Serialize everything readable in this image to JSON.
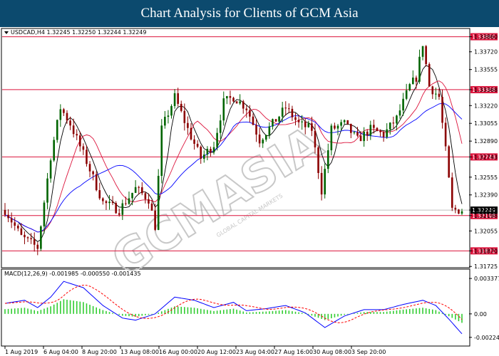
{
  "header": {
    "title": "Chart Analysis for Clients of GCM Asia"
  },
  "price_panel": {
    "info": "USDCAD,H4  1.32245 1.32250 1.32244 1.32249",
    "axis_ticks": [
      "1.33860",
      "1.33720",
      "1.33555",
      "1.33368",
      "1.33220",
      "1.33055",
      "1.32890",
      "1.32743",
      "1.32555",
      "1.32390",
      "1.32249",
      "1.32198",
      "1.32055",
      "1.31870",
      "1.31725"
    ],
    "levels": [
      {
        "label": "1.33860",
        "color": "#dc143c"
      },
      {
        "label": "1.33368",
        "color": "#dc143c"
      },
      {
        "label": "1.32743",
        "color": "#dc143c"
      },
      {
        "label": "1.32198",
        "color": "#dc143c"
      },
      {
        "label": "1.31870",
        "color": "#dc143c"
      }
    ],
    "current_price": {
      "label": "1.32249",
      "color": "#000000"
    }
  },
  "macd_panel": {
    "info": "MACD(12,26,9) -0.001985 -0.000550 -0.001435",
    "axis_ticks": [
      "0.003377",
      "0.00",
      "-0.00224"
    ]
  },
  "x_axis": {
    "labels": [
      "1 Aug 2019",
      "6 Aug 04:00",
      "8 Aug 20:00",
      "13 Aug 08:00",
      "16 Aug 00:00",
      "20 Aug 12:00",
      "23 Aug 04:00",
      "27 Aug 16:00",
      "30 Aug 08:00",
      "3 Sep 20:00"
    ]
  },
  "watermark": {
    "text": "GCMASIA",
    "subtext": "GLOBAL CAPITAL MARKETS"
  },
  "colors": {
    "header_bg": "#0c4a6e",
    "bull": "#006400",
    "bear": "#8b0000",
    "ma_fast": "#000000",
    "ma_mid": "#dc143c",
    "ma_slow": "#0000ff",
    "macd_hist": "#32cd32",
    "signal": "#ff0000"
  },
  "chart_data": {
    "type": "candlestick",
    "symbol": "USDCAD",
    "timeframe": "H4",
    "ylim": [
      1.3172,
      1.3393
    ],
    "overall_path": [
      [
        0,
        1.3225
      ],
      [
        5,
        1.32
      ],
      [
        10,
        1.319
      ],
      [
        14,
        1.3275
      ],
      [
        17,
        1.332
      ],
      [
        20,
        1.3305
      ],
      [
        25,
        1.327
      ],
      [
        30,
        1.3232
      ],
      [
        35,
        1.3225
      ],
      [
        40,
        1.3245
      ],
      [
        44,
        1.3235
      ],
      [
        46,
        1.321
      ],
      [
        48,
        1.33
      ],
      [
        52,
        1.333
      ],
      [
        56,
        1.33
      ],
      [
        60,
        1.3273
      ],
      [
        64,
        1.3286
      ],
      [
        67,
        1.3325
      ],
      [
        70,
        1.333
      ],
      [
        74,
        1.332
      ],
      [
        78,
        1.329
      ],
      [
        82,
        1.3305
      ],
      [
        86,
        1.332
      ],
      [
        90,
        1.3305
      ],
      [
        94,
        1.33
      ],
      [
        97,
        1.3243
      ],
      [
        100,
        1.33
      ],
      [
        104,
        1.3305
      ],
      [
        108,
        1.329
      ],
      [
        112,
        1.33
      ],
      [
        116,
        1.3295
      ],
      [
        120,
        1.331
      ],
      [
        124,
        1.334
      ],
      [
        126,
        1.3348
      ],
      [
        128,
        1.338
      ],
      [
        130,
        1.334
      ],
      [
        133,
        1.333
      ],
      [
        135,
        1.328
      ],
      [
        137,
        1.3225
      ],
      [
        140,
        1.3225
      ]
    ],
    "macd_path": [
      [
        0,
        0.001
      ],
      [
        6,
        0.0013
      ],
      [
        10,
        0.0006
      ],
      [
        14,
        0.0016
      ],
      [
        18,
        0.0031
      ],
      [
        24,
        0.0025
      ],
      [
        30,
        0.0008
      ],
      [
        36,
        -0.0004
      ],
      [
        40,
        -0.0006
      ],
      [
        46,
        0.0
      ],
      [
        52,
        0.0016
      ],
      [
        58,
        0.0013
      ],
      [
        64,
        0.0006
      ],
      [
        70,
        0.0011
      ],
      [
        74,
        0.0003
      ],
      [
        80,
        0.0005
      ],
      [
        86,
        0.0008
      ],
      [
        92,
        0.0001
      ],
      [
        98,
        -0.0013
      ],
      [
        104,
        -0.0002
      ],
      [
        110,
        0.0004
      ],
      [
        116,
        0.0004
      ],
      [
        122,
        0.0009
      ],
      [
        128,
        0.0013
      ],
      [
        132,
        0.0008
      ],
      [
        136,
        -0.0005
      ],
      [
        140,
        -0.0019
      ]
    ]
  }
}
